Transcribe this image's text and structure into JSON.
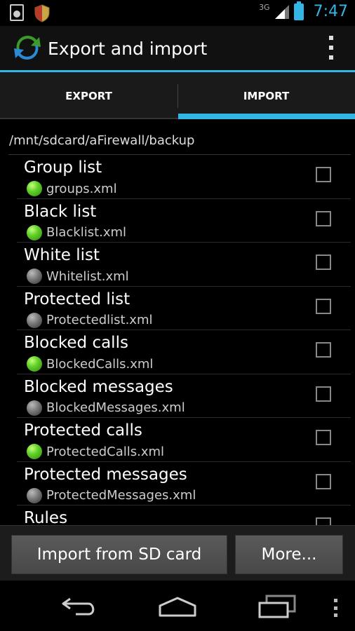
{
  "status_bar": {
    "network_type": "3G",
    "time": "7:47",
    "icons": [
      "sd-card-icon",
      "shield-icon",
      "signal-icon",
      "battery-charging-icon"
    ]
  },
  "action_bar": {
    "title": "Export and import",
    "app_icon": "sync-arrows-icon",
    "overflow_icon": "overflow-menu-icon"
  },
  "tabs": [
    {
      "label": "EXPORT",
      "selected": false
    },
    {
      "label": "IMPORT",
      "selected": true
    }
  ],
  "path": "/mnt/sdcard/aFirewall/backup",
  "items": [
    {
      "title": "Group list",
      "file": "groups.xml",
      "status": "green",
      "checked": false
    },
    {
      "title": "Black list",
      "file": "Blacklist.xml",
      "status": "green",
      "checked": false
    },
    {
      "title": "White list",
      "file": "Whitelist.xml",
      "status": "grey",
      "checked": false
    },
    {
      "title": "Protected list",
      "file": "Protectedlist.xml",
      "status": "grey",
      "checked": false
    },
    {
      "title": "Blocked calls",
      "file": "BlockedCalls.xml",
      "status": "green",
      "checked": false
    },
    {
      "title": "Blocked messages",
      "file": "BlockedMessages.xml",
      "status": "grey",
      "checked": false
    },
    {
      "title": "Protected calls",
      "file": "ProtectedCalls.xml",
      "status": "green",
      "checked": false
    },
    {
      "title": "Protected messages",
      "file": "ProtectedMessages.xml",
      "status": "grey",
      "checked": false
    },
    {
      "title": "Rules",
      "file": "",
      "status": "",
      "checked": false
    }
  ],
  "buttons": {
    "import": "Import from SD card",
    "more": "More..."
  },
  "colors": {
    "accent": "#33b5e5",
    "status_green": "#62d12a",
    "status_grey": "#777777"
  },
  "nav_bar": {
    "icons": [
      "back-icon",
      "home-icon",
      "recent-apps-icon",
      "menu-icon"
    ]
  }
}
